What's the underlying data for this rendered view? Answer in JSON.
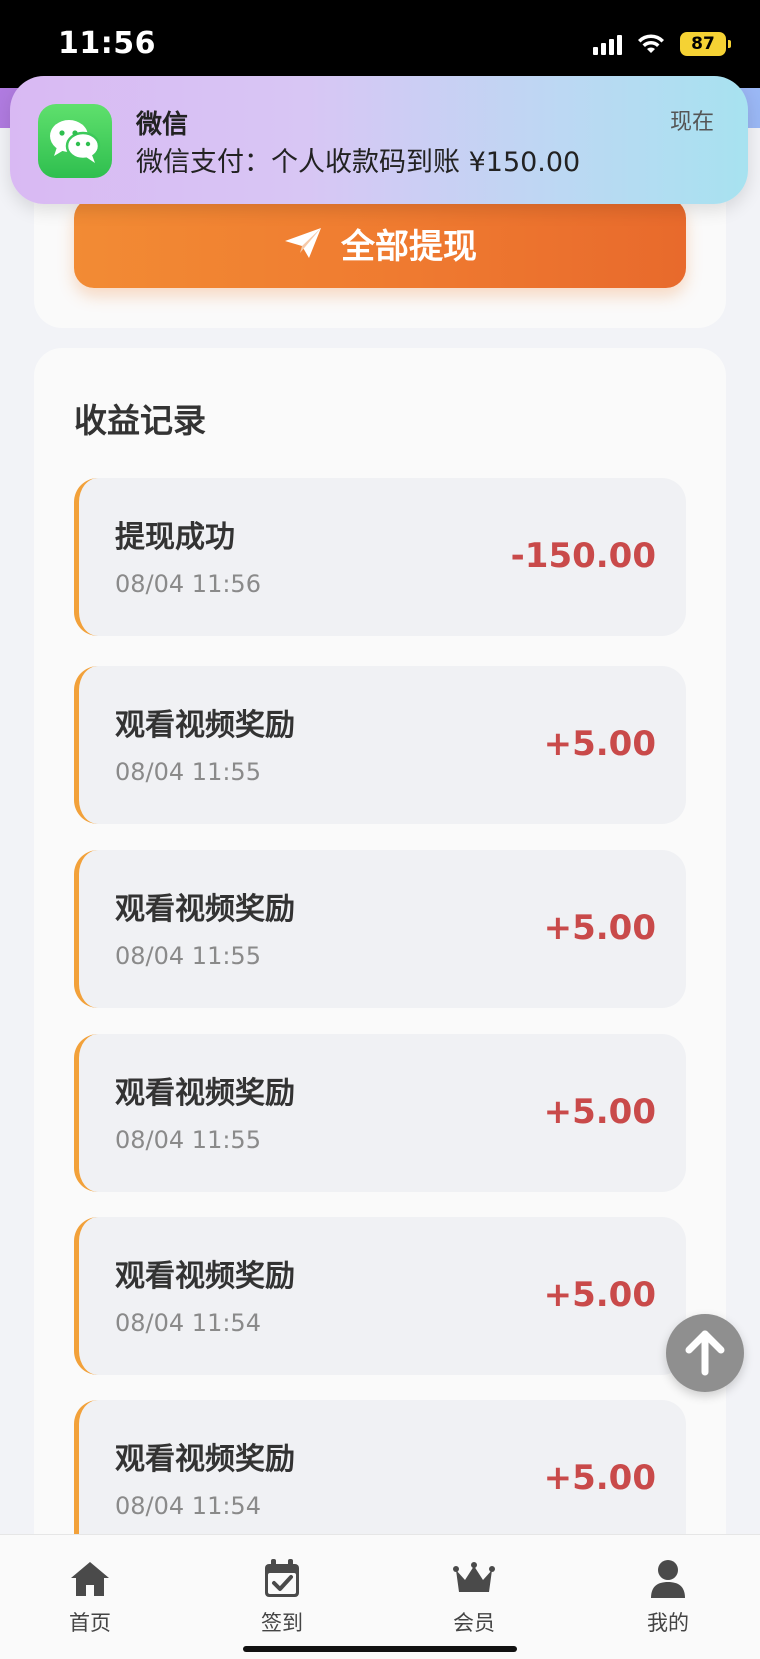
{
  "status_bar": {
    "time": "11:56",
    "battery": "87"
  },
  "notification": {
    "app_name": "微信",
    "message": "微信支付：个人收款码到账 ¥150.00",
    "time": "现在"
  },
  "withdraw": {
    "label": "全部提现"
  },
  "records": {
    "title": "收益记录",
    "items": [
      {
        "title": "提现成功",
        "time": "08/04 11:56",
        "amount": "-150.00"
      },
      {
        "title": "观看视频奖励",
        "time": "08/04 11:55",
        "amount": "+5.00"
      },
      {
        "title": "观看视频奖励",
        "time": "08/04 11:55",
        "amount": "+5.00"
      },
      {
        "title": "观看视频奖励",
        "time": "08/04 11:55",
        "amount": "+5.00"
      },
      {
        "title": "观看视频奖励",
        "time": "08/04 11:54",
        "amount": "+5.00"
      },
      {
        "title": "观看视频奖励",
        "time": "08/04 11:54",
        "amount": "+5.00"
      }
    ]
  },
  "bottom_nav": [
    {
      "label": "首页",
      "icon": "home-icon"
    },
    {
      "label": "签到",
      "icon": "calendar-check-icon"
    },
    {
      "label": "会员",
      "icon": "crown-icon"
    },
    {
      "label": "我的",
      "icon": "user-icon"
    }
  ],
  "colors": {
    "accent_orange": "#ef7a30",
    "amount_red": "#c94a4a",
    "wechat_green": "#2fbf4f"
  }
}
